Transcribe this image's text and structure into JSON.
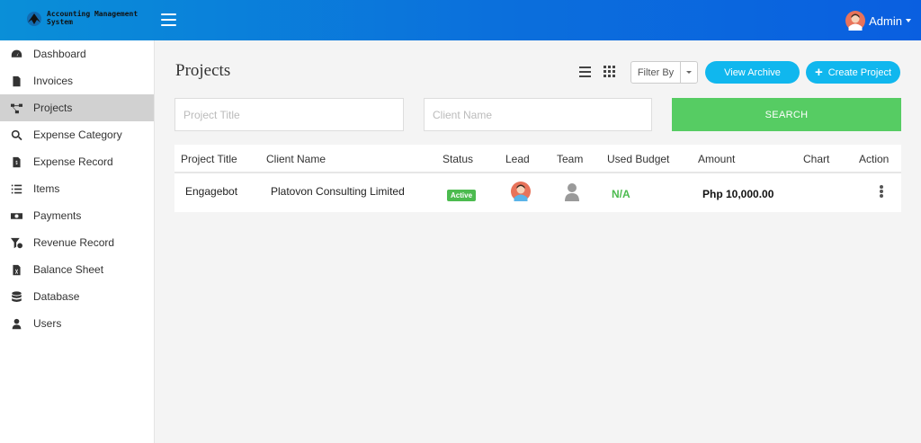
{
  "header": {
    "logo_line1": "Accounting Management",
    "logo_line2": "System",
    "user_name": "Admin",
    "accent_color": "#0b6fdc"
  },
  "sidebar": {
    "items": [
      {
        "label": "Dashboard",
        "icon": "dashboard-icon"
      },
      {
        "label": "Invoices",
        "icon": "invoice-icon"
      },
      {
        "label": "Projects",
        "icon": "projects-icon",
        "active": true
      },
      {
        "label": "Expense Category",
        "icon": "search-dollar-icon"
      },
      {
        "label": "Expense Record",
        "icon": "file-dollar-icon"
      },
      {
        "label": "Items",
        "icon": "list-icon"
      },
      {
        "label": "Payments",
        "icon": "money-bill-icon"
      },
      {
        "label": "Revenue Record",
        "icon": "funnel-dollar-icon"
      },
      {
        "label": "Balance Sheet",
        "icon": "file-excel-icon"
      },
      {
        "label": "Database",
        "icon": "database-icon"
      },
      {
        "label": "Users",
        "icon": "user-icon"
      }
    ]
  },
  "main": {
    "title": "Projects",
    "filter_label": "Filter By",
    "view_archive_label": "View Archive",
    "create_project_label": "Create Project",
    "search": {
      "project_title_placeholder": "Project Title",
      "client_name_placeholder": "Client Name",
      "button_label": "SEARCH",
      "button_color": "#56cc63"
    },
    "table": {
      "columns": [
        "Project Title",
        "Client Name",
        "Status",
        "Lead",
        "Team",
        "Used Budget",
        "Amount",
        "Chart",
        "Action"
      ],
      "rows": [
        {
          "project_title": "Engagebot",
          "client_name": "Platovon Consulting Limited",
          "status": "Active",
          "used_budget": "N/A",
          "amount": "Php 10,000.00"
        }
      ]
    }
  }
}
